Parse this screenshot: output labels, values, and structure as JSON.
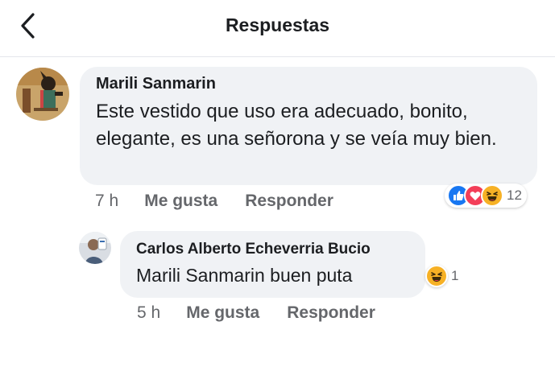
{
  "header": {
    "title": "Respuestas",
    "back_icon": "chevron-left-icon"
  },
  "colors": {
    "bubble_bg": "#f0f2f5",
    "meta_text": "#65676b",
    "like_blue": "#1877f2",
    "love_red": "#f33e58",
    "haha_yellow": "#f7b125"
  },
  "comments": [
    {
      "author": "Marili Sanmarin",
      "text": "Este vestido que uso era adecuado, bonito, elegante, es una señorona y se veía muy bien.",
      "time": "7 h",
      "like_label": "Me gusta",
      "reply_label": "Responder",
      "reactions": [
        "like-icon",
        "love-icon",
        "haha-icon"
      ],
      "reaction_count": "12"
    },
    {
      "author": "Carlos Alberto Echeverria Bucio",
      "text": "Marili Sanmarin buen puta",
      "time": "5 h",
      "like_label": "Me gusta",
      "reply_label": "Responder",
      "reactions": [
        "haha-icon"
      ],
      "reaction_count": "1"
    }
  ]
}
